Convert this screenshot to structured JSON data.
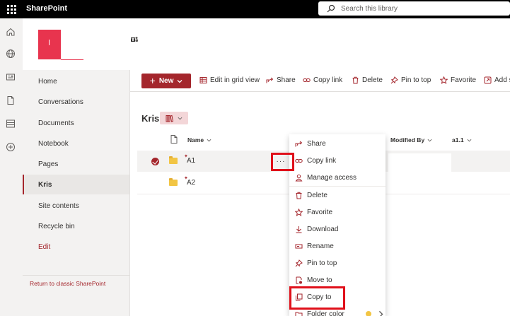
{
  "suite": {
    "app_name": "SharePoint",
    "search_placeholder": "Search this library"
  },
  "nav": {
    "items": [
      {
        "label": "Home"
      },
      {
        "label": "Conversations"
      },
      {
        "label": "Documents"
      },
      {
        "label": "Notebook"
      },
      {
        "label": "Pages"
      },
      {
        "label": "Kris",
        "active": true
      },
      {
        "label": "Site contents"
      },
      {
        "label": "Recycle bin"
      },
      {
        "label": "Edit"
      }
    ],
    "return_link": "Return to classic SharePoint"
  },
  "commandbar": {
    "new_label": "New",
    "edit_grid": "Edit in grid view",
    "share": "Share",
    "copy_link": "Copy link",
    "delete": "Delete",
    "pin_to_top": "Pin to top",
    "favorite": "Favorite",
    "add_shortcut": "Add s"
  },
  "library": {
    "title": "Kris"
  },
  "columns": {
    "name": "Name",
    "modified_by": "Modified By",
    "a11": "a1.1"
  },
  "rows": [
    {
      "name": "A1",
      "selected": true
    },
    {
      "name": "A2",
      "selected": false
    }
  ],
  "context_menu": {
    "items": [
      {
        "label": "Share",
        "icon": "share-icon"
      },
      {
        "label": "Copy link",
        "icon": "link-icon"
      },
      {
        "label": "Manage access",
        "icon": "people-icon"
      },
      {
        "label": "Delete",
        "icon": "trash-icon"
      },
      {
        "label": "Favorite",
        "icon": "star-icon"
      },
      {
        "label": "Download",
        "icon": "download-icon"
      },
      {
        "label": "Rename",
        "icon": "rename-icon"
      },
      {
        "label": "Pin to top",
        "icon": "pin-icon"
      },
      {
        "label": "Move to",
        "icon": "move-icon"
      },
      {
        "label": "Copy to",
        "icon": "copy-icon"
      },
      {
        "label": "Folder color",
        "icon": "folder-color-icon"
      }
    ]
  },
  "colors": {
    "accent": "#a4262c",
    "highlight_box": "#e0101a",
    "folder": "#f2c544",
    "logo": "#e8344e"
  }
}
